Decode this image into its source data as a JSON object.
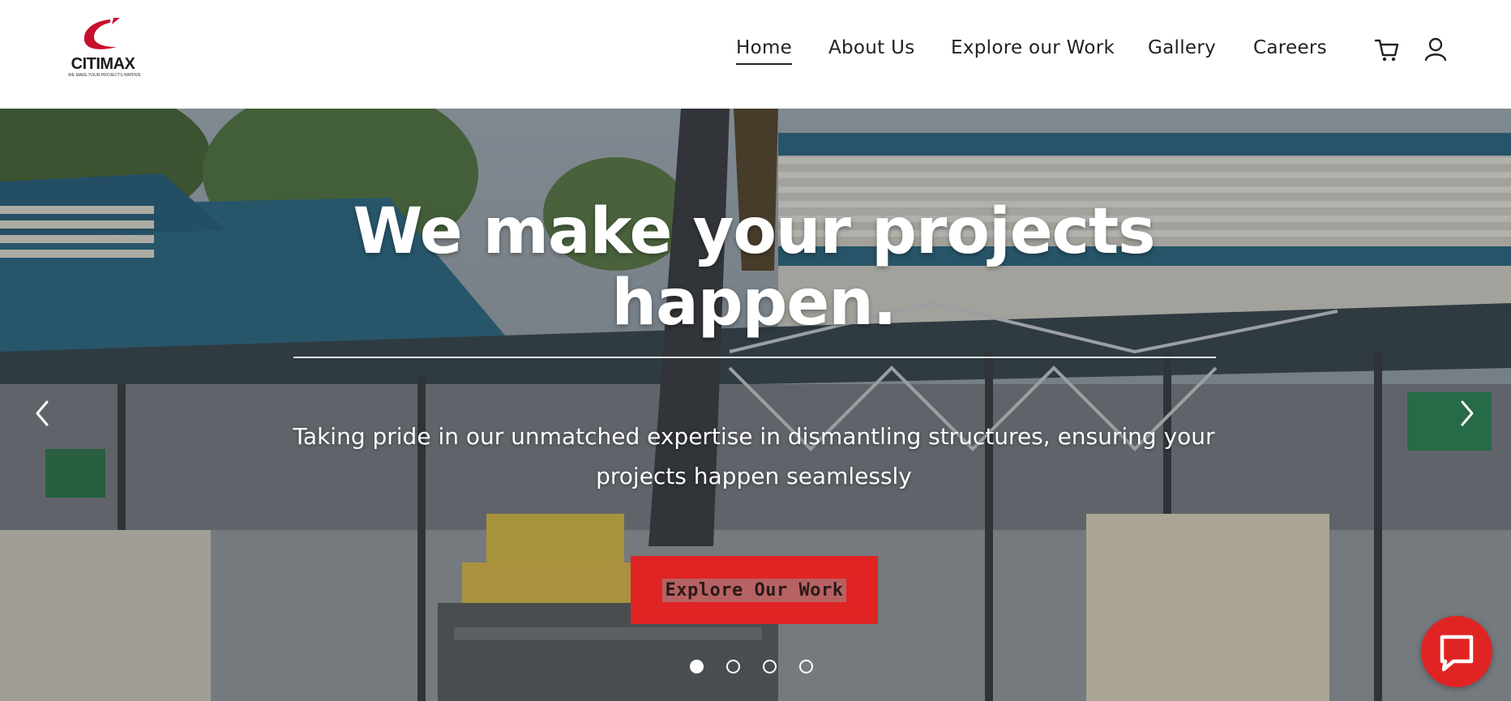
{
  "brand": {
    "name": "CITIMAX",
    "tagline": "WE MAKE YOUR PROJECTS HAPPEN",
    "accent_color": "#e02424"
  },
  "nav": {
    "items": [
      {
        "label": "Home",
        "active": true
      },
      {
        "label": "About Us",
        "active": false
      },
      {
        "label": "Explore our Work",
        "active": false
      },
      {
        "label": "Gallery",
        "active": false
      },
      {
        "label": "Careers",
        "active": false
      }
    ],
    "icons": [
      "cart-icon",
      "user-icon"
    ]
  },
  "hero": {
    "title_line1": "We make your projects",
    "title_line2": "happen.",
    "subtitle_line1": "Taking pride in our unmatched expertise in dismantling structures, ensuring your",
    "subtitle_line2": "projects happen seamlessly",
    "cta_label": "Explore Our Work",
    "slides_total": 4,
    "slide_active": 1,
    "prev_icon": "chevron-left-icon",
    "next_icon": "chevron-right-icon"
  },
  "chat": {
    "icon": "chat-bubble-icon"
  }
}
